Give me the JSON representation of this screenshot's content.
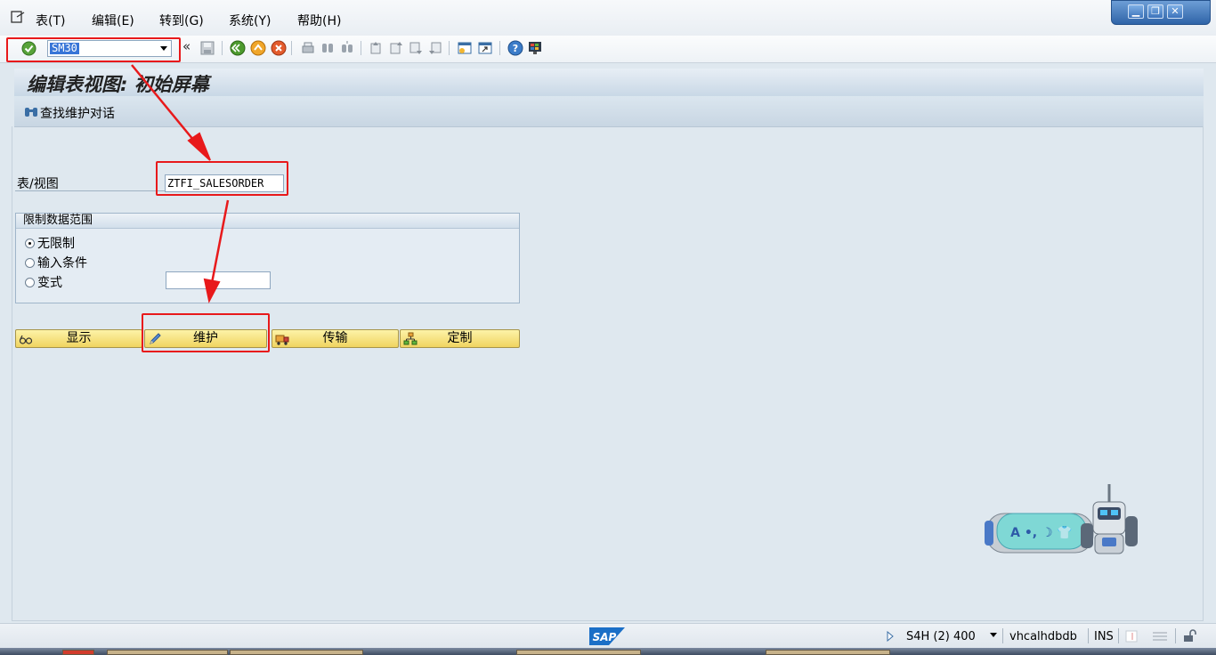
{
  "menu": {
    "items": [
      "表(T)",
      "编辑(E)",
      "转到(G)",
      "系统(Y)",
      "帮助(H)"
    ]
  },
  "toolbar": {
    "command_value": "SM30",
    "collapse_glyph": "«"
  },
  "screen": {
    "title": "编辑表视图: 初始屏幕",
    "find_label": "查找维护对话"
  },
  "form": {
    "table_label": "表/视图",
    "table_value": "ZTFI_SALESORDER",
    "group_title": "限制数据范围",
    "radio_no_restriction": "无限制",
    "radio_enter_conditions": "输入条件",
    "radio_variant": "变式",
    "variant_value": ""
  },
  "buttons": {
    "display": "显示",
    "maintain": "维护",
    "transport": "传输",
    "customize": "定制"
  },
  "robot": {
    "bubble_text": "A •, ☽ 👕"
  },
  "status": {
    "system": "S4H (2) 400",
    "server": "vhcalhdbdb",
    "mode": "INS",
    "logo": "SAP"
  },
  "colors": {
    "annotation_red": "#e8191b",
    "button_yellow": "#f0d460",
    "background": "#dfe8ef"
  }
}
